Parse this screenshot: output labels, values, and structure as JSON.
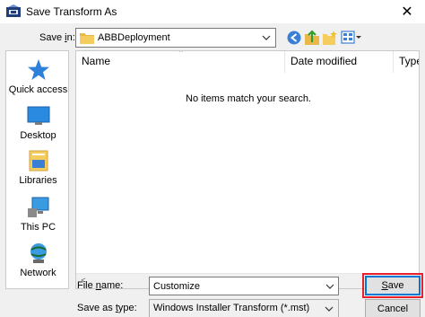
{
  "window": {
    "title": "Save Transform As",
    "close_glyph": "✕"
  },
  "toolbar": {
    "save_in_label_pre": "Save ",
    "save_in_label_u": "i",
    "save_in_label_post": "n:",
    "location": "ABBDeployment",
    "icons": [
      "back-icon",
      "up-folder-icon",
      "new-folder-icon",
      "view-menu-icon"
    ]
  },
  "places": [
    {
      "label": "Quick access",
      "icon": "quick-access-star-icon"
    },
    {
      "label": "Desktop",
      "icon": "desktop-icon"
    },
    {
      "label": "Libraries",
      "icon": "libraries-icon"
    },
    {
      "label": "This PC",
      "icon": "this-pc-icon"
    },
    {
      "label": "Network",
      "icon": "network-icon"
    }
  ],
  "file_list": {
    "columns": [
      "Name",
      "Date modified",
      "Type"
    ],
    "empty_message": "No items match your search.",
    "scroll_left": "<",
    "scroll_right": ">"
  },
  "fields": {
    "file_name_label_pre": "File ",
    "file_name_label_u": "n",
    "file_name_label_post": "ame:",
    "file_name_value": "Customize",
    "save_type_label_pre": "Save as ",
    "save_type_label_u": "t",
    "save_type_label_post": "ype:",
    "save_type_value": "Windows Installer Transform (*.mst)"
  },
  "buttons": {
    "save_u": "S",
    "save_rest": "ave",
    "cancel": "Cancel"
  },
  "colors": {
    "accent": "#0078d7",
    "highlight": "#e8202a"
  }
}
